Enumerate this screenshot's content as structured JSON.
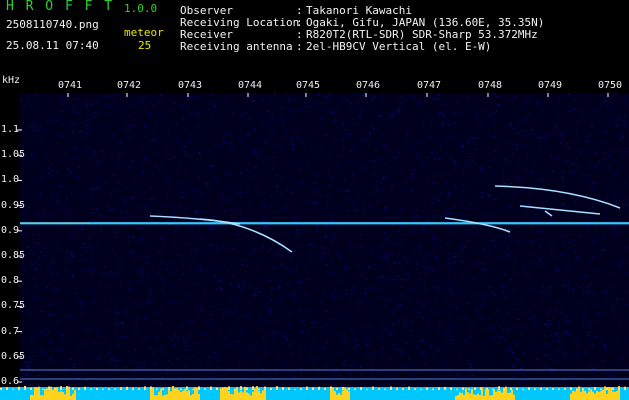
{
  "header": {
    "app_name": "H R O F F T",
    "version": "1.0.0",
    "filename": "2508110740.png",
    "datetime": "25.08.11 07:40",
    "meteor_label": "meteor",
    "meteor_count": "25",
    "info": [
      {
        "key": "Observer",
        "sep": ":",
        "value": "Takanori Kawachi"
      },
      {
        "key": "Receiving Location",
        "sep": ":",
        "value": "Ogaki, Gifu, JAPAN (136.60E, 35.35N)"
      },
      {
        "key": "Receiver",
        "sep": ":",
        "value": "R820T2(RTL-SDR) SDR-Sharp 53.372MHz"
      },
      {
        "key": "Receiving antenna",
        "sep": ":",
        "value": "2el-HB9CV Vertical (el. E-W)"
      }
    ]
  },
  "spectrogram": {
    "unit_label": "kHz",
    "time_labels": [
      "0741",
      "0742",
      "0743",
      "0744",
      "0745",
      "0746",
      "0747",
      "0748",
      "0749",
      "0750"
    ],
    "freq_labels": [
      "1.1",
      "1.05",
      "1.0",
      "0.95",
      "0.9",
      "0.85",
      "0.8",
      "0.75",
      "0.7",
      "0.65",
      "0.6"
    ],
    "freq_range_khz": [
      0.6,
      1.1
    ],
    "carrier_khz": 0.915,
    "colors": {
      "background": "#000000",
      "noise": "#0a0a8c",
      "carrier": "#35c8ff",
      "trace": "#a8e0ff",
      "activity_fill": "#ffd21e",
      "activity_line": "#00c8ff",
      "guide_line": "#5a78c8"
    }
  }
}
